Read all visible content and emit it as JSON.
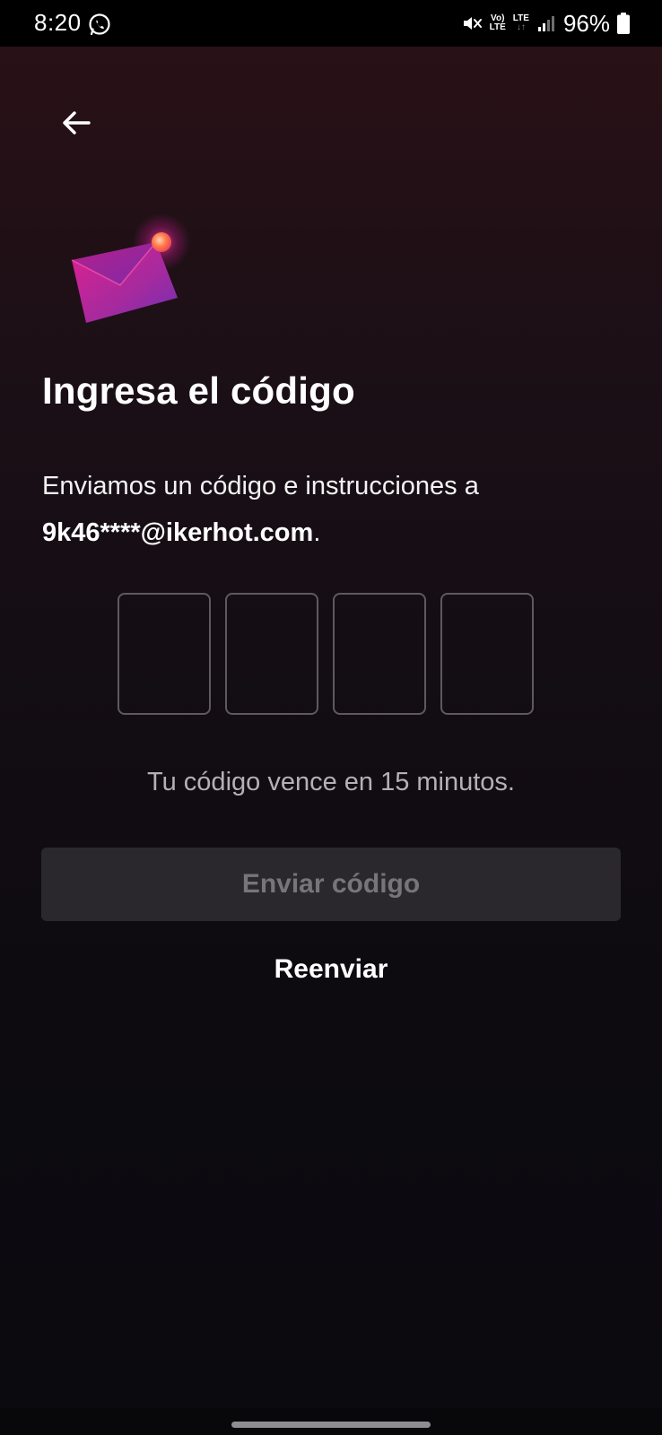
{
  "status_bar": {
    "time": "8:20",
    "volte_top": "Vo)",
    "volte_bottom": "LTE",
    "network": "LTE",
    "battery_percent": "96%",
    "icons": [
      "whatsapp-icon",
      "mute-icon",
      "signal-icon",
      "battery-icon"
    ]
  },
  "header": {
    "back_icon": "arrow-left-icon"
  },
  "illustration": {
    "icon": "envelope-notification-icon",
    "colors": [
      "#c2188a",
      "#7b2fbe",
      "#ff6a3d"
    ]
  },
  "content": {
    "title": "Ingresa el código",
    "instructions": "Enviamos un código e instrucciones a",
    "email": "9k46****@ikerhot.com",
    "email_suffix": ".",
    "code_digits": [
      "",
      "",
      "",
      ""
    ],
    "expiry_note": "Tu código vence en 15 minutos."
  },
  "actions": {
    "submit_label": "Enviar código",
    "resend_label": "Reenviar"
  },
  "colors": {
    "background_top": "#2a1117",
    "background_bottom": "#0b0a0f",
    "button_disabled_bg": "#2a282d",
    "button_disabled_text": "#77747a"
  }
}
